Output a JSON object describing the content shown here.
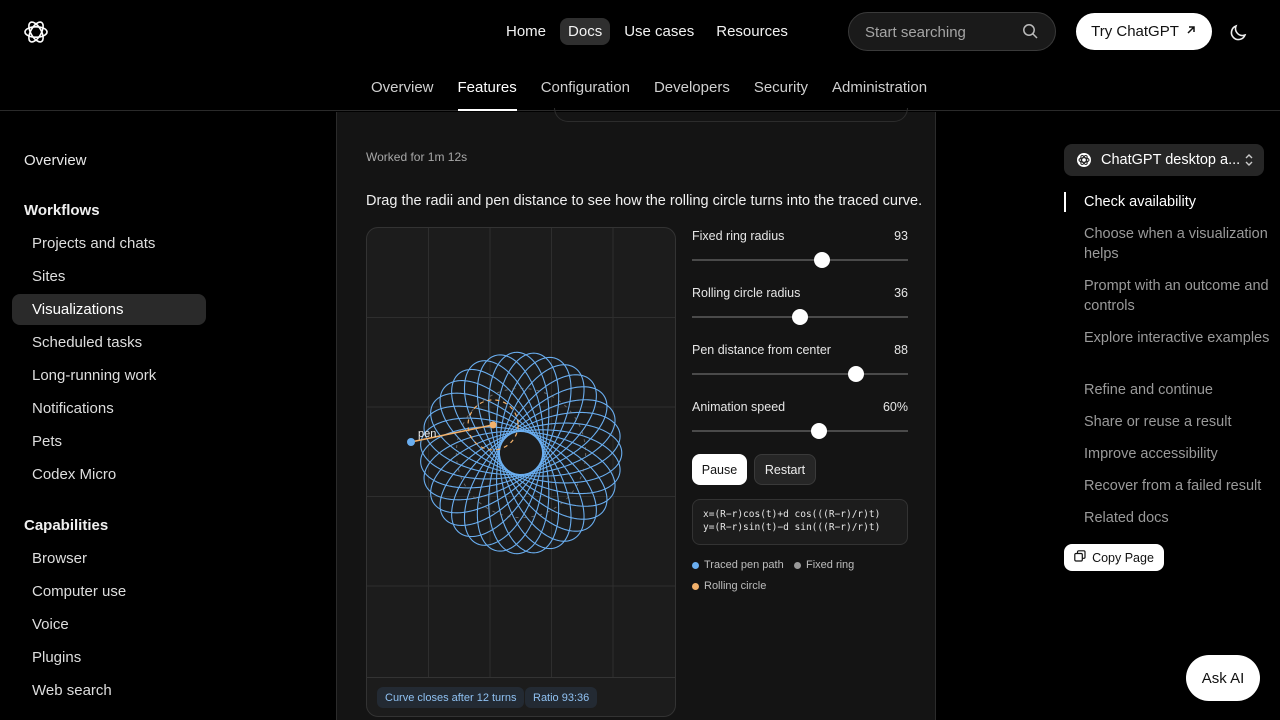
{
  "header": {
    "nav": [
      "Home",
      "Docs",
      "Use cases",
      "Resources"
    ],
    "search_placeholder": "Start searching",
    "try_label": "Try ChatGPT"
  },
  "subnav": {
    "tabs": [
      "Overview",
      "Features",
      "Configuration",
      "Developers",
      "Security",
      "Administration"
    ]
  },
  "sidebar": {
    "overview": "Overview",
    "workflows_title": "Workflows",
    "workflows": [
      "Projects and chats",
      "Sites",
      "Visualizations",
      "Scheduled tasks",
      "Long-running work",
      "Notifications",
      "Pets",
      "Codex Micro"
    ],
    "capabilities_title": "Capabilities",
    "capabilities": [
      "Browser",
      "Computer use",
      "Voice",
      "Plugins",
      "Web search"
    ]
  },
  "main": {
    "worked": "Worked for 1m 12s",
    "instruction": "Drag the radii and pen distance to see how the rolling circle turns into the traced curve.",
    "viz": {
      "pen_label": "pen",
      "pill_closes": "Curve closes after 12 turns",
      "pill_ratio": "Ratio 93:36"
    },
    "controls": [
      {
        "label": "Fixed ring radius",
        "value": "93",
        "fraction": 0.6
      },
      {
        "label": "Rolling circle radius",
        "value": "36",
        "fraction": 0.5
      },
      {
        "label": "Pen distance from center",
        "value": "88",
        "fraction": 0.76
      },
      {
        "label": "Animation speed",
        "value": "60%",
        "fraction": 0.59
      }
    ],
    "pause_label": "Pause",
    "restart_label": "Restart",
    "formula_x": "x=(R−r)cos(t)+d cos(((R−r)/r)t)",
    "formula_y": "y=(R−r)sin(t)−d sin(((R−r)/r)t)",
    "legend": [
      "Traced pen path",
      "Fixed ring",
      "Rolling circle"
    ],
    "colors": {
      "traced": "#6aaef0",
      "ring": "#9a9a9a",
      "rolling": "#f2b16b"
    }
  },
  "toc": {
    "selector_label": "ChatGPT desktop a...",
    "items": [
      "Check availability",
      "Choose when a visualization helps",
      "Prompt with an outcome and controls",
      "Explore interactive examples",
      "Refine and continue",
      "Share or reuse a result",
      "Improve accessibility",
      "Recover from a failed result",
      "Related docs"
    ],
    "copy_label": "Copy Page"
  },
  "ask_ai_label": "Ask AI"
}
